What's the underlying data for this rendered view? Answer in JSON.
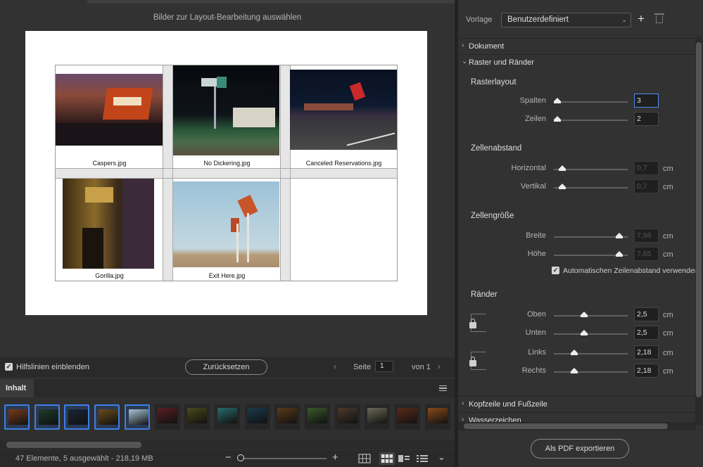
{
  "preview": {
    "title": "Bilder zur Layout-Bearbeitung auswählen",
    "cells": [
      {
        "caption": "Caspers.jpg",
        "colors": [
          "#5a2a1a",
          "#c2451a",
          "#2c1f2a"
        ]
      },
      {
        "caption": "No Dickering.jpg",
        "colors": [
          "#0b0d12",
          "#3f7a4c",
          "#8a7a6a"
        ]
      },
      {
        "caption": "Canceled Reservations.jpg",
        "colors": [
          "#0d1526",
          "#2a3f5a",
          "#6a6a6a"
        ]
      },
      {
        "caption": "Gorilla.jpg",
        "colors": [
          "#2a1c0d",
          "#8a6a2a",
          "#c8a04a"
        ]
      },
      {
        "caption": "Exit Here.jpg",
        "colors": [
          "#9fc6dc",
          "#c9dce4",
          "#b59a78"
        ]
      }
    ]
  },
  "options": {
    "guides_label": "Hilfslinien einblenden",
    "guides_checked": true,
    "reset_label": "Zurücksetzen",
    "page_label": "Seite",
    "page_value": "1",
    "page_of": "von 1"
  },
  "content_panel": {
    "tab": "Inhalt",
    "thumbnails": [
      {
        "selected": true,
        "color": "#7a3a1a"
      },
      {
        "selected": true,
        "color": "#1e3a2a"
      },
      {
        "selected": true,
        "color": "#1a2436"
      },
      {
        "selected": true,
        "color": "#6a4a1a"
      },
      {
        "selected": true,
        "color": "#a8c4d4"
      },
      {
        "selected": false,
        "color": "#5a1e24"
      },
      {
        "selected": false,
        "color": "#4a4a1a"
      },
      {
        "selected": false,
        "color": "#2a6a6a"
      },
      {
        "selected": false,
        "color": "#1a3a4a"
      },
      {
        "selected": false,
        "color": "#5a3a1a"
      },
      {
        "selected": false,
        "color": "#3a5a2a"
      },
      {
        "selected": false,
        "color": "#4a3a2a"
      },
      {
        "selected": false,
        "color": "#6a6a5a"
      },
      {
        "selected": false,
        "color": "#5a2a1a"
      },
      {
        "selected": false,
        "color": "#8a4a1a"
      }
    ]
  },
  "status": {
    "text": "47 Elemente, 5 ausgewählt - 218,19 MB",
    "zoom_level": 0.0
  },
  "panel": {
    "vorlage_label": "Vorlage",
    "vorlage_value": "Benutzerdefiniert",
    "sections": {
      "dokument": "Dokument",
      "raster": "Raster und Ränder",
      "kopf": "Kopfzeile und Fußzeile",
      "wasser": "Wasserzeichen"
    },
    "rasterlayout": {
      "title": "Rasterlayout",
      "spalten_label": "Spalten",
      "spalten_value": "3",
      "spalten_level": 0.0,
      "zeilen_label": "Zeilen",
      "zeilen_value": "2",
      "zeilen_level": 0.0
    },
    "zellenabstand": {
      "title": "Zellenabstand",
      "horizontal_label": "Horizontal",
      "horizontal_value": "0,7",
      "horizontal_level": 0.07,
      "vertikal_label": "Vertikal",
      "vertikal_value": "0,7",
      "vertikal_level": 0.07,
      "unit": "cm"
    },
    "zellengroesse": {
      "title": "Zellengröße",
      "breite_label": "Breite",
      "breite_value": "7,98",
      "breite_level": 0.93,
      "hoehe_label": "Höhe",
      "hoehe_value": "7,65",
      "hoehe_level": 0.93,
      "unit": "cm",
      "auto_label": "Automatischen Zeilenabstand verwenden",
      "auto_checked": true
    },
    "raender": {
      "title": "Ränder",
      "oben_label": "Oben",
      "oben_value": "2,5",
      "oben_level": 0.4,
      "unten_label": "Unten",
      "unten_value": "2,5",
      "unten_level": 0.4,
      "links_label": "Links",
      "links_value": "2,18",
      "links_level": 0.25,
      "rechts_label": "Rechts",
      "rechts_value": "2,18",
      "rechts_level": 0.25,
      "unit": "cm"
    },
    "export_label": "Als PDF exportieren"
  }
}
